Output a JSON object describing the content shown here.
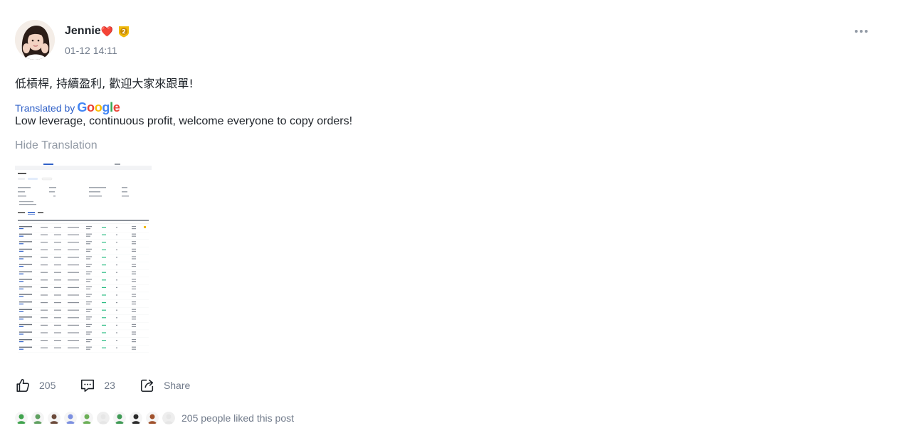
{
  "post": {
    "author": "Jennie",
    "author_heart": "❤️",
    "badge_number": "2",
    "date": "01-12 14:11",
    "text": "低槓桿, 持續盈利, 歡迎大家來跟單!",
    "translated_by_label": "Translated by",
    "google_letters": [
      {
        "ch": "G",
        "color": "#4285F4"
      },
      {
        "ch": "o",
        "color": "#EA4335"
      },
      {
        "ch": "o",
        "color": "#FBBC05"
      },
      {
        "ch": "g",
        "color": "#4285F4"
      },
      {
        "ch": "l",
        "color": "#34A853"
      },
      {
        "ch": "e",
        "color": "#EA4335"
      }
    ],
    "translation": "Low leverage, continuous profit, welcome everyone to copy orders!",
    "hide_translation": "Hide Translation"
  },
  "actions": {
    "like_count": "205",
    "comment_count": "23",
    "share_label": "Share"
  },
  "likers": {
    "summary": "205 people liked this post",
    "avatar_colors": [
      "#3fa34d",
      "#5fa060",
      "#6b4a3a",
      "#7b8fe0",
      "#6caf57",
      "#e6e6e6",
      "#3f9a55",
      "#2a2a2a",
      "#a0522d",
      "#e6e6e6"
    ]
  },
  "colors": {
    "accent": "#3061c8",
    "muted": "#707a8a",
    "text": "#1e2329"
  }
}
